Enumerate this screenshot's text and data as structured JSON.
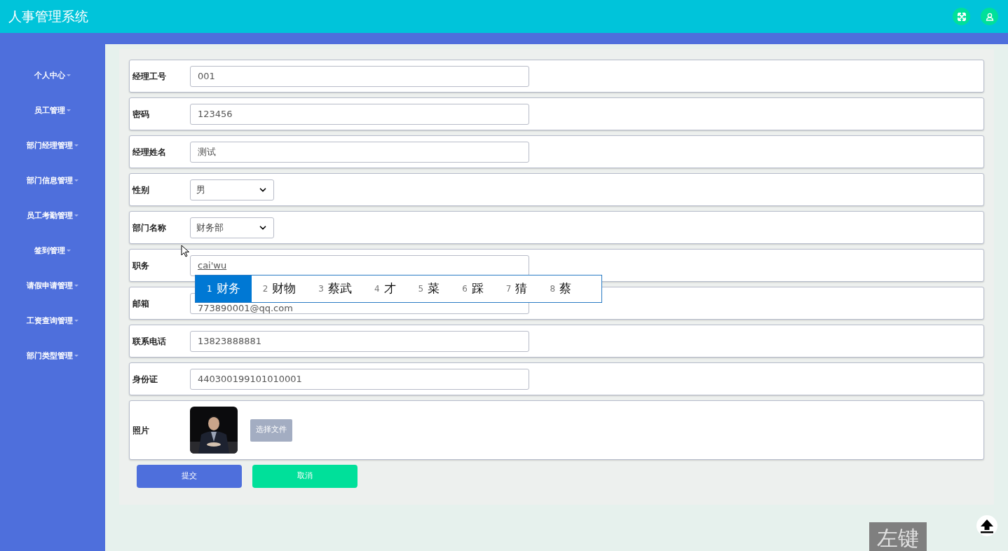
{
  "header": {
    "title": "人事管理系统"
  },
  "sidebar": {
    "items": [
      {
        "label": "个人中心"
      },
      {
        "label": "员工管理"
      },
      {
        "label": "部门经理管理"
      },
      {
        "label": "部门信息管理"
      },
      {
        "label": "员工考勤管理"
      },
      {
        "label": "签到管理"
      },
      {
        "label": "请假申请管理"
      },
      {
        "label": "工资查询管理"
      },
      {
        "label": "部门类型管理"
      }
    ]
  },
  "form": {
    "fields": [
      {
        "kind": "input",
        "label": "经理工号",
        "value": "001"
      },
      {
        "kind": "input",
        "label": "密码",
        "value": "123456"
      },
      {
        "kind": "input",
        "label": "经理姓名",
        "value": "测试"
      },
      {
        "kind": "select",
        "label": "性别",
        "value": "男"
      },
      {
        "kind": "select",
        "label": "部门名称",
        "value": "财务部"
      },
      {
        "kind": "input",
        "label": "职务",
        "value": "cai'wu",
        "composing": true
      },
      {
        "kind": "input",
        "label": "邮箱",
        "value": "773890001@qq.com"
      },
      {
        "kind": "input",
        "label": "联系电话",
        "value": "13823888881"
      },
      {
        "kind": "input",
        "label": "身份证",
        "value": "440300199101010001"
      },
      {
        "label": "照片",
        "button": "选择文件"
      }
    ],
    "buttons": [
      {
        "label": "提交",
        "kind": "primary"
      },
      {
        "label": "取消",
        "kind": "secondary"
      }
    ]
  },
  "ime": {
    "candidates": [
      {
        "index": "1",
        "text": "财务",
        "selected": true
      },
      {
        "index": "2",
        "text": "财物",
        "selected": false
      },
      {
        "index": "3",
        "text": "蔡武",
        "selected": false
      },
      {
        "index": "4",
        "text": "才",
        "selected": false
      },
      {
        "index": "5",
        "text": "菜",
        "selected": false
      },
      {
        "index": "6",
        "text": "踩",
        "selected": false
      },
      {
        "index": "7",
        "text": "猜",
        "selected": false
      },
      {
        "index": "8",
        "text": "蔡",
        "selected": false
      }
    ]
  },
  "key_overlay": {
    "text": "左键"
  }
}
